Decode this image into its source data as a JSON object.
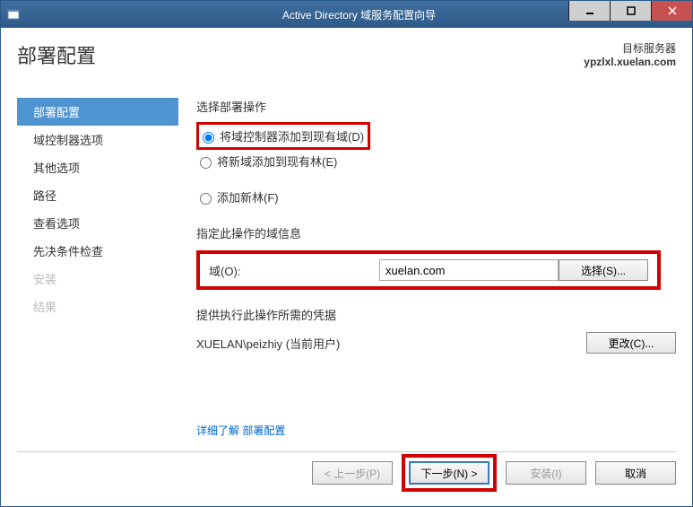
{
  "titlebar": {
    "title": "Active Directory 域服务配置向导"
  },
  "header": {
    "title": "部署配置",
    "target_label": "目标服务器",
    "target_server": "ypzlxl.xuelan.com"
  },
  "sidebar": {
    "items": [
      {
        "label": "部署配置",
        "state": "active"
      },
      {
        "label": "域控制器选项",
        "state": ""
      },
      {
        "label": "其他选项",
        "state": ""
      },
      {
        "label": "路径",
        "state": ""
      },
      {
        "label": "查看选项",
        "state": ""
      },
      {
        "label": "先决条件检查",
        "state": ""
      },
      {
        "label": "安装",
        "state": "disabled"
      },
      {
        "label": "结果",
        "state": "disabled"
      }
    ]
  },
  "main": {
    "select_op_label": "选择部署操作",
    "radios": {
      "r1": "将域控制器添加到现有域(D)",
      "r2": "将新域添加到现有林(E)",
      "r3": "添加新林(F)"
    },
    "domain_section_label": "指定此操作的域信息",
    "domain_field_label": "域(O):",
    "domain_value": "xuelan.com",
    "select_button": "选择(S)...",
    "cred_section_label": "提供执行此操作所需的凭据",
    "cred_user": "XUELAN\\peizhiy (当前用户)",
    "change_button": "更改(C)...",
    "learn_more": "详细了解 部署配置"
  },
  "footer": {
    "prev": "< 上一步(P)",
    "next": "下一步(N) >",
    "install": "安装(I)",
    "cancel": "取消"
  }
}
